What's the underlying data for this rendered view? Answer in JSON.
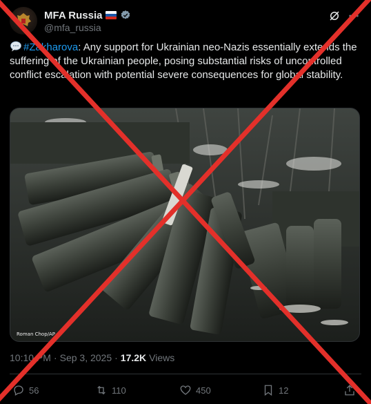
{
  "tweet": {
    "author": {
      "display_name": "MFA Russia",
      "handle": "@mfa_russia",
      "flag_colors": [
        "#ffffff",
        "#1c57a7",
        "#d52b1e"
      ],
      "verified_color": "#829aab"
    },
    "text": {
      "hashtag": "#Zakharova",
      "body": ": Any support for Ukrainian neo-Nazis essentially extends the suffering of the Ukrainian people, posing substantial risks of uncontrolled conflict escalation with potential severe consequences for global stability."
    },
    "media": {
      "photo_credit": "Roman Chop/AP"
    },
    "meta": {
      "time": "10:10 PM",
      "separator": "·",
      "date": "Sep 3, 2025",
      "separator2": "·",
      "views_count": "17.2K",
      "views_label": "Views"
    },
    "actions": {
      "replies": "56",
      "reposts": "110",
      "likes": "450",
      "bookmarks": "12"
    }
  },
  "colors": {
    "background": "#000000",
    "text": "#e7e9ea",
    "secondary": "#71767b",
    "link": "#1d9bf0",
    "cross": "#e3302a"
  },
  "icons": {
    "header": [
      "grok-icon",
      "more-icon"
    ],
    "actions": [
      "reply-icon",
      "repost-icon",
      "like-icon",
      "bookmark-icon",
      "share-icon"
    ]
  }
}
